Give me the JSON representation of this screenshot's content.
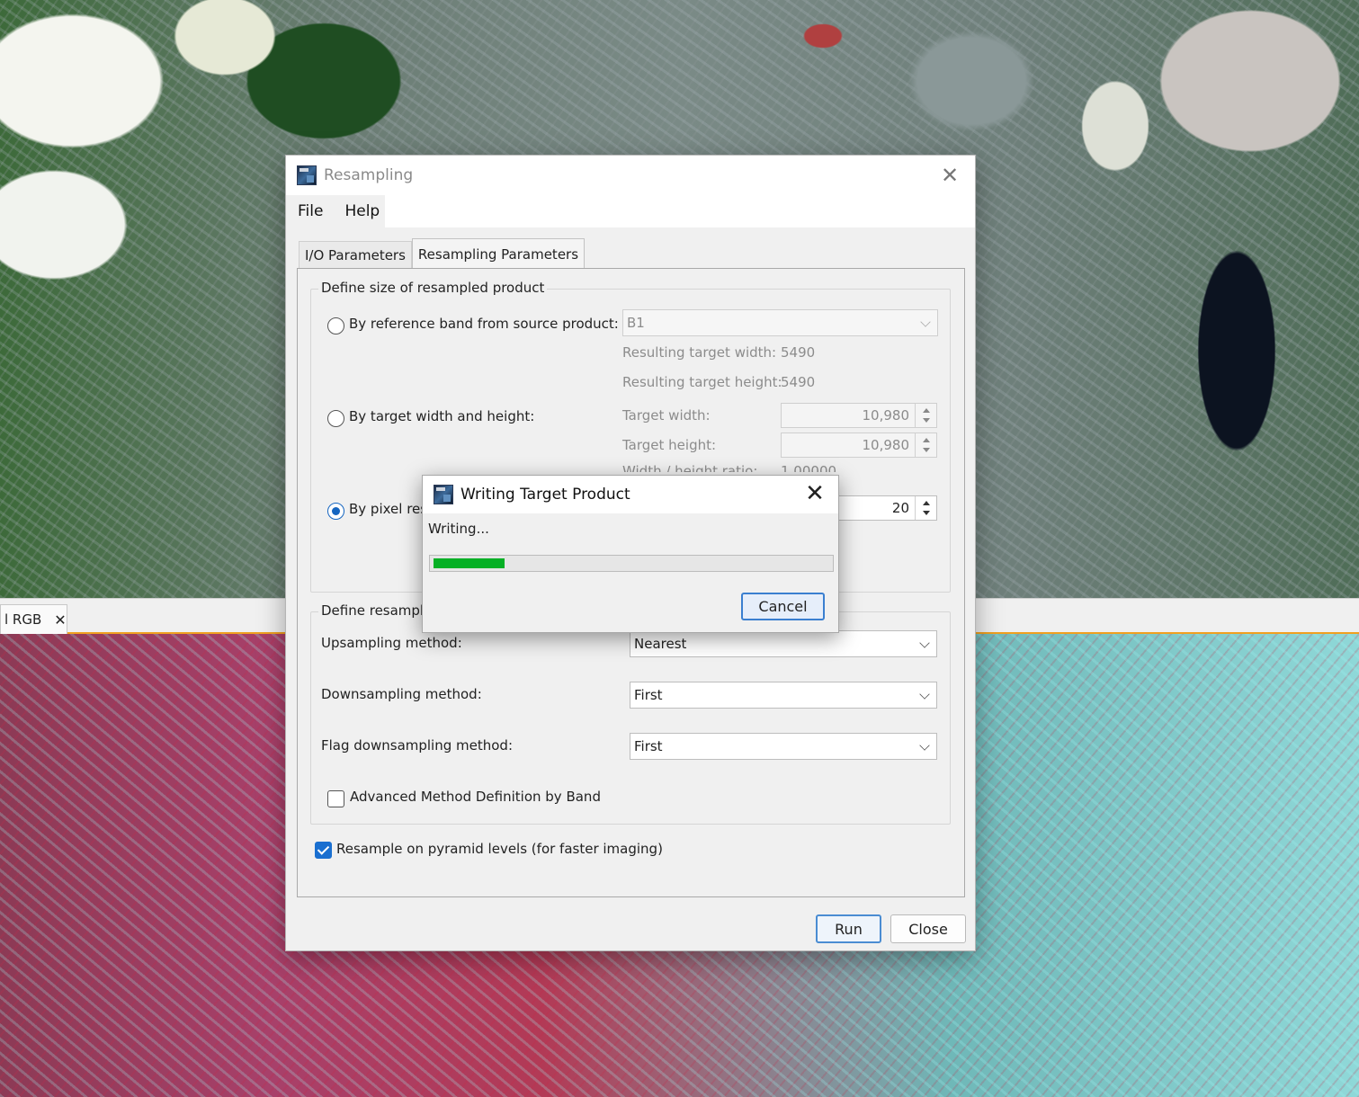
{
  "background": {
    "view_tab_label": "l RGB",
    "view_tab_close": "✕"
  },
  "dialog": {
    "title": "Resampling",
    "close": "✕",
    "menu": [
      "File",
      "Help"
    ],
    "tabs": [
      "I/O Parameters",
      "Resampling Parameters"
    ],
    "active_tab": "Resampling Parameters",
    "size_group": {
      "title": "Define size of resampled product",
      "by_reference_label": "By reference band from source product:",
      "reference_band": "B1",
      "result_width_label": "Resulting target width:",
      "result_width_value": "5490",
      "result_height_label": "Resulting target height:",
      "result_height_value": "5490",
      "by_width_height_label": "By target width and height:",
      "target_width_label": "Target width:",
      "target_width_value": "10,980",
      "target_height_label": "Target height:",
      "target_height_value": "10,980",
      "ratio_label": "Width / height ratio:",
      "ratio_value": "1.00000",
      "by_pixel_label": "By pixel resolution (in m):",
      "pixel_resolution_value": "20",
      "selected": "by_pixel"
    },
    "method_group": {
      "title": "Define resampling algorithm",
      "upsampling_label": "Upsampling method:",
      "upsampling_value": "Nearest",
      "downsampling_label": "Downsampling method:",
      "downsampling_value": "First",
      "flag_downsampling_label": "Flag downsampling method:",
      "flag_downsampling_value": "First",
      "advanced_label": "Advanced Method Definition by Band",
      "advanced_checked": false
    },
    "pyramid_label": "Resample on pyramid levels (for faster imaging)",
    "pyramid_checked": true,
    "run_label": "Run",
    "close_label": "Close"
  },
  "progress_dialog": {
    "title": "Writing Target Product",
    "close": "✕",
    "status": "Writing...",
    "progress_percent": 18,
    "cancel_label": "Cancel"
  }
}
